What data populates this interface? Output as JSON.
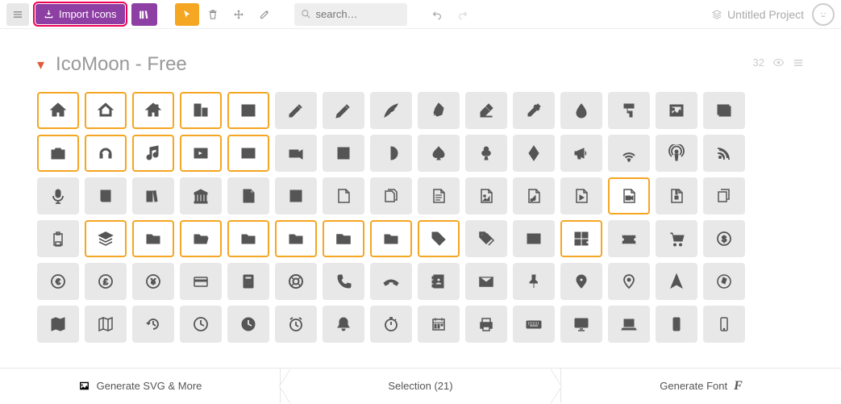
{
  "toolbar": {
    "import_label": "Import Icons",
    "search_placeholder": "search…"
  },
  "project": {
    "name": "Untitled Project"
  },
  "set": {
    "title": "IcoMoon - Free",
    "count": "32"
  },
  "bottom": {
    "svg_label": "Generate SVG & More",
    "selection_label": "Selection (21)",
    "font_label": "Generate Font"
  },
  "icons": [
    {
      "n": "home",
      "sel": true
    },
    {
      "n": "home2",
      "sel": true
    },
    {
      "n": "home3",
      "sel": true
    },
    {
      "n": "office",
      "sel": true
    },
    {
      "n": "newspaper",
      "sel": true
    },
    {
      "n": "pencil",
      "sel": false
    },
    {
      "n": "pencil2",
      "sel": false
    },
    {
      "n": "quill",
      "sel": false
    },
    {
      "n": "pen",
      "sel": false
    },
    {
      "n": "blog",
      "sel": false
    },
    {
      "n": "eyedropper",
      "sel": false
    },
    {
      "n": "droplet",
      "sel": false
    },
    {
      "n": "paint-format",
      "sel": false
    },
    {
      "n": "image",
      "sel": false
    },
    {
      "n": "images",
      "sel": false
    },
    {
      "n": "camera",
      "sel": true
    },
    {
      "n": "headphones",
      "sel": true
    },
    {
      "n": "music",
      "sel": true
    },
    {
      "n": "play",
      "sel": true
    },
    {
      "n": "film",
      "sel": true
    },
    {
      "n": "video-camera",
      "sel": false
    },
    {
      "n": "dice",
      "sel": false
    },
    {
      "n": "pacman",
      "sel": false
    },
    {
      "n": "spades",
      "sel": false
    },
    {
      "n": "clubs",
      "sel": false
    },
    {
      "n": "diamonds",
      "sel": false
    },
    {
      "n": "bullhorn",
      "sel": false
    },
    {
      "n": "connection",
      "sel": false
    },
    {
      "n": "podcast",
      "sel": false
    },
    {
      "n": "feed",
      "sel": false
    },
    {
      "n": "mic",
      "sel": false
    },
    {
      "n": "book",
      "sel": false
    },
    {
      "n": "books",
      "sel": false
    },
    {
      "n": "library",
      "sel": false
    },
    {
      "n": "file-text",
      "sel": false
    },
    {
      "n": "profile",
      "sel": false
    },
    {
      "n": "file-empty",
      "sel": false
    },
    {
      "n": "files-empty",
      "sel": false
    },
    {
      "n": "file-text2",
      "sel": false
    },
    {
      "n": "file-picture",
      "sel": false
    },
    {
      "n": "file-music",
      "sel": false
    },
    {
      "n": "file-play",
      "sel": false
    },
    {
      "n": "file-video",
      "sel": true
    },
    {
      "n": "file-zip",
      "sel": false
    },
    {
      "n": "copy",
      "sel": false
    },
    {
      "n": "paste",
      "sel": false
    },
    {
      "n": "stack",
      "sel": true
    },
    {
      "n": "folder",
      "sel": true
    },
    {
      "n": "folder-open",
      "sel": true
    },
    {
      "n": "folder-plus",
      "sel": true
    },
    {
      "n": "folder-minus",
      "sel": true
    },
    {
      "n": "folder-download",
      "sel": true
    },
    {
      "n": "folder-upload",
      "sel": true
    },
    {
      "n": "price-tag",
      "sel": true
    },
    {
      "n": "price-tags",
      "sel": false
    },
    {
      "n": "barcode",
      "sel": false
    },
    {
      "n": "qrcode",
      "sel": true
    },
    {
      "n": "ticket",
      "sel": false
    },
    {
      "n": "cart",
      "sel": false
    },
    {
      "n": "coin-dollar",
      "sel": false
    },
    {
      "n": "coin-euro",
      "sel": false
    },
    {
      "n": "coin-pound",
      "sel": false
    },
    {
      "n": "coin-yen",
      "sel": false
    },
    {
      "n": "credit-card",
      "sel": false
    },
    {
      "n": "calculator",
      "sel": false
    },
    {
      "n": "lifebuoy",
      "sel": false
    },
    {
      "n": "phone",
      "sel": false
    },
    {
      "n": "phone-hang-up",
      "sel": false
    },
    {
      "n": "address-book",
      "sel": false
    },
    {
      "n": "envelop",
      "sel": false
    },
    {
      "n": "pushpin",
      "sel": false
    },
    {
      "n": "location",
      "sel": false
    },
    {
      "n": "location2",
      "sel": false
    },
    {
      "n": "compass",
      "sel": false
    },
    {
      "n": "compass2",
      "sel": false
    },
    {
      "n": "map",
      "sel": false
    },
    {
      "n": "map2",
      "sel": false
    },
    {
      "n": "history",
      "sel": false
    },
    {
      "n": "clock",
      "sel": false
    },
    {
      "n": "clock2",
      "sel": false
    },
    {
      "n": "alarm",
      "sel": false
    },
    {
      "n": "bell",
      "sel": false
    },
    {
      "n": "stopwatch",
      "sel": false
    },
    {
      "n": "calendar",
      "sel": false
    },
    {
      "n": "printer",
      "sel": false
    },
    {
      "n": "keyboard",
      "sel": false
    },
    {
      "n": "display",
      "sel": false
    },
    {
      "n": "laptop",
      "sel": false
    },
    {
      "n": "mobile",
      "sel": false
    },
    {
      "n": "mobile2",
      "sel": false
    }
  ]
}
